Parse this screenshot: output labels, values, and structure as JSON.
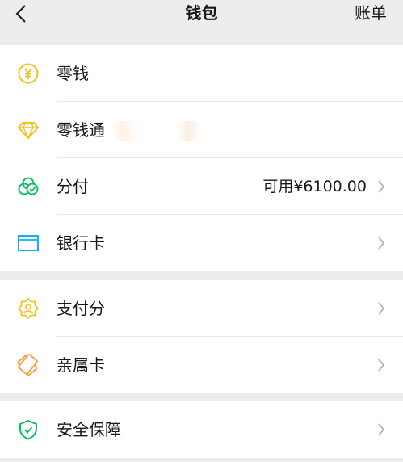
{
  "header": {
    "title": "钱包",
    "bill_label": "账单"
  },
  "sections": [
    {
      "items": [
        {
          "label": "零钱",
          "icon": "coin-yuan-icon"
        },
        {
          "label": "零钱通",
          "icon": "diamond-icon"
        },
        {
          "label": "分付",
          "icon": "fenfu-icon",
          "value": "可用¥6100.00"
        },
        {
          "label": "银行卡",
          "icon": "bank-card-icon"
        }
      ]
    },
    {
      "items": [
        {
          "label": "支付分",
          "icon": "payment-score-icon"
        },
        {
          "label": "亲属卡",
          "icon": "family-card-icon"
        }
      ]
    },
    {
      "items": [
        {
          "label": "安全保障",
          "icon": "security-shield-icon"
        }
      ]
    }
  ],
  "colors": {
    "yellow": "#f4c21b",
    "green": "#07c160",
    "blue": "#10aeff",
    "orange": "#fa9d3b",
    "background": "#ededed"
  }
}
